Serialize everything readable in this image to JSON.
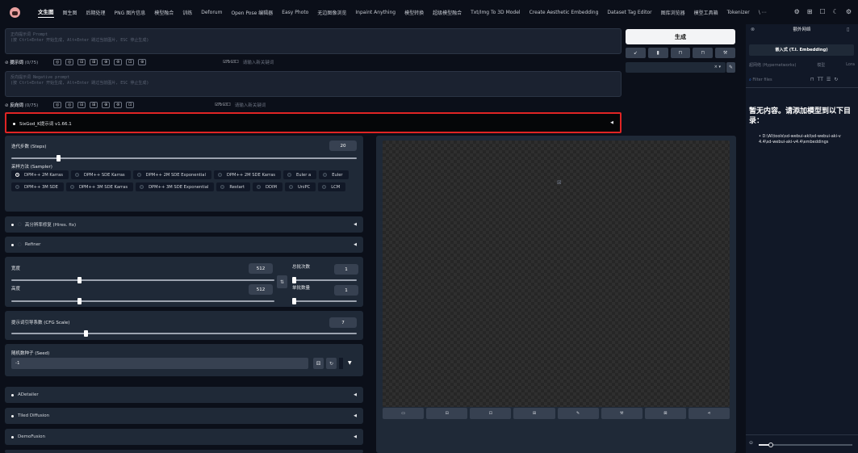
{
  "nav": {
    "tabs": [
      "文生图",
      "图生图",
      "后期处理",
      "PNG 图片信息",
      "模型融合",
      "训练",
      "Deforum",
      "Open Pose 编辑器",
      "Easy Photo",
      "无边图像浏览",
      "Inpaint Anything",
      "模型转换",
      "超级模型融合",
      "Txt/Img To 3D Model",
      "Create Aesthetic Embedding",
      "Dataset Tag Editor",
      "图库浏览器",
      "模型工具箱",
      "Tokenizer"
    ],
    "more": "\\  ⋯"
  },
  "prompt": {
    "placeholder_line1": "正向提示词 Prompt",
    "placeholder_line2": "(按 Ctrl+Enter 开始生成, Alt+Enter 跳过当前图片, ESC 停止生成)",
    "label": "提示词",
    "count": "(0/75)",
    "keyword_placeholder": "请输入新关键词"
  },
  "negative": {
    "placeholder_line1": "反向提示词 Negative prompt",
    "placeholder_line2": "(按 Ctrl+Enter 开始生成, Alt+Enter 跳过当前图片, ESC 停止生成)",
    "label": "反向词",
    "count": "(0/75)",
    "keyword_placeholder": "请输入新关键词"
  },
  "generate_label": "生成",
  "sixgod": {
    "title": "SixGod_K提示词 v1.66.1"
  },
  "steps": {
    "label": "迭代步数 (Steps)",
    "value": "20",
    "fraction": 0.13
  },
  "sampler": {
    "label": "采样方法 (Sampler)",
    "options": [
      "DPM++ 2M Karras",
      "DPM++ SDE Karras",
      "DPM++ 2M SDE Exponential",
      "DPM++ 2M SDE Karras",
      "Euler a",
      "Euler",
      "DPM++ 3M SDE",
      "DPM++ 3M SDE Karras",
      "DPM++ 3M SDE Exponential",
      "Restart",
      "DDIM",
      "UniPC",
      "LCM"
    ],
    "selected": 0
  },
  "hires": {
    "title": "高分辨率修复 (Hires. fix)"
  },
  "refiner": {
    "title": "Refiner"
  },
  "width": {
    "label": "宽度",
    "value": "512",
    "fraction": 0.25
  },
  "height": {
    "label": "高度",
    "value": "512",
    "fraction": 0.25
  },
  "batch_count": {
    "label": "总批次数",
    "value": "1"
  },
  "batch_size": {
    "label": "单批数量",
    "value": "1"
  },
  "cfg": {
    "label": "提示词引导系数 (CFG Scale)",
    "value": "7",
    "fraction": 0.21
  },
  "seed": {
    "label": "随机数种子 (Seed)",
    "value": "-1"
  },
  "accordions": [
    "ADetailer",
    "Tiled Diffusion",
    "DemoFusion"
  ],
  "right_panel": {
    "header": "额外网络",
    "tabs": [
      "嵌入式 (T.I. Embedding)",
      "超网络 (Hypernetworks)",
      "模型",
      "Lora"
    ],
    "filter_placeholder": "Filter files",
    "empty_title": "暂无内容。请添加模型到以下目录：",
    "empty_path": "D:\\AI\\tools\\sd-webui-aki\\sd-webui-aki-v4.4\\sd-webui-aki-v4.4\\embeddings"
  },
  "colors": {
    "bg": "#0b0f19",
    "panel": "#1f2937",
    "highlight": "#e02424"
  }
}
